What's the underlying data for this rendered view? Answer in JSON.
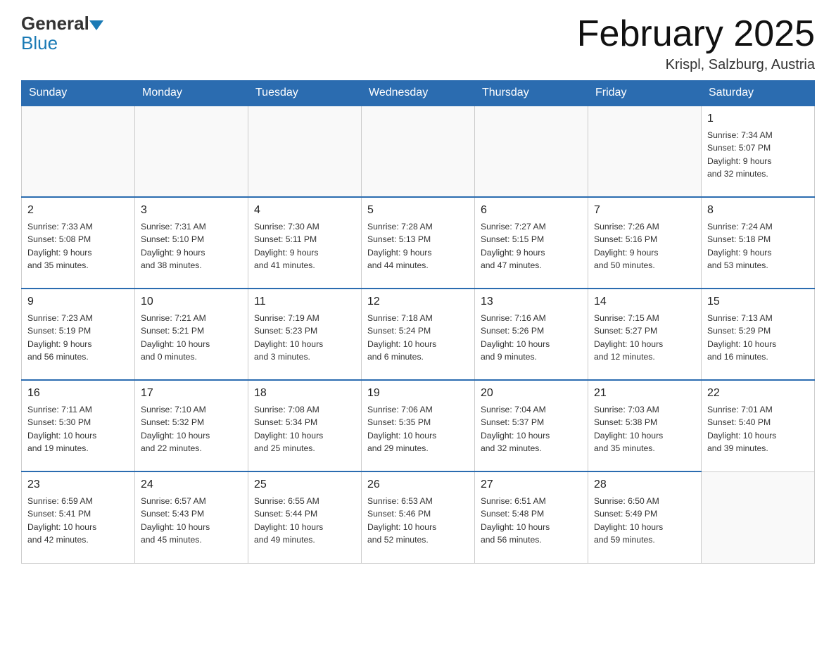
{
  "header": {
    "logo_general": "General",
    "logo_blue": "Blue",
    "title": "February 2025",
    "subtitle": "Krispl, Salzburg, Austria"
  },
  "weekdays": [
    "Sunday",
    "Monday",
    "Tuesday",
    "Wednesday",
    "Thursday",
    "Friday",
    "Saturday"
  ],
  "weeks": [
    [
      {
        "day": "",
        "info": ""
      },
      {
        "day": "",
        "info": ""
      },
      {
        "day": "",
        "info": ""
      },
      {
        "day": "",
        "info": ""
      },
      {
        "day": "",
        "info": ""
      },
      {
        "day": "",
        "info": ""
      },
      {
        "day": "1",
        "info": "Sunrise: 7:34 AM\nSunset: 5:07 PM\nDaylight: 9 hours\nand 32 minutes."
      }
    ],
    [
      {
        "day": "2",
        "info": "Sunrise: 7:33 AM\nSunset: 5:08 PM\nDaylight: 9 hours\nand 35 minutes."
      },
      {
        "day": "3",
        "info": "Sunrise: 7:31 AM\nSunset: 5:10 PM\nDaylight: 9 hours\nand 38 minutes."
      },
      {
        "day": "4",
        "info": "Sunrise: 7:30 AM\nSunset: 5:11 PM\nDaylight: 9 hours\nand 41 minutes."
      },
      {
        "day": "5",
        "info": "Sunrise: 7:28 AM\nSunset: 5:13 PM\nDaylight: 9 hours\nand 44 minutes."
      },
      {
        "day": "6",
        "info": "Sunrise: 7:27 AM\nSunset: 5:15 PM\nDaylight: 9 hours\nand 47 minutes."
      },
      {
        "day": "7",
        "info": "Sunrise: 7:26 AM\nSunset: 5:16 PM\nDaylight: 9 hours\nand 50 minutes."
      },
      {
        "day": "8",
        "info": "Sunrise: 7:24 AM\nSunset: 5:18 PM\nDaylight: 9 hours\nand 53 minutes."
      }
    ],
    [
      {
        "day": "9",
        "info": "Sunrise: 7:23 AM\nSunset: 5:19 PM\nDaylight: 9 hours\nand 56 minutes."
      },
      {
        "day": "10",
        "info": "Sunrise: 7:21 AM\nSunset: 5:21 PM\nDaylight: 10 hours\nand 0 minutes."
      },
      {
        "day": "11",
        "info": "Sunrise: 7:19 AM\nSunset: 5:23 PM\nDaylight: 10 hours\nand 3 minutes."
      },
      {
        "day": "12",
        "info": "Sunrise: 7:18 AM\nSunset: 5:24 PM\nDaylight: 10 hours\nand 6 minutes."
      },
      {
        "day": "13",
        "info": "Sunrise: 7:16 AM\nSunset: 5:26 PM\nDaylight: 10 hours\nand 9 minutes."
      },
      {
        "day": "14",
        "info": "Sunrise: 7:15 AM\nSunset: 5:27 PM\nDaylight: 10 hours\nand 12 minutes."
      },
      {
        "day": "15",
        "info": "Sunrise: 7:13 AM\nSunset: 5:29 PM\nDaylight: 10 hours\nand 16 minutes."
      }
    ],
    [
      {
        "day": "16",
        "info": "Sunrise: 7:11 AM\nSunset: 5:30 PM\nDaylight: 10 hours\nand 19 minutes."
      },
      {
        "day": "17",
        "info": "Sunrise: 7:10 AM\nSunset: 5:32 PM\nDaylight: 10 hours\nand 22 minutes."
      },
      {
        "day": "18",
        "info": "Sunrise: 7:08 AM\nSunset: 5:34 PM\nDaylight: 10 hours\nand 25 minutes."
      },
      {
        "day": "19",
        "info": "Sunrise: 7:06 AM\nSunset: 5:35 PM\nDaylight: 10 hours\nand 29 minutes."
      },
      {
        "day": "20",
        "info": "Sunrise: 7:04 AM\nSunset: 5:37 PM\nDaylight: 10 hours\nand 32 minutes."
      },
      {
        "day": "21",
        "info": "Sunrise: 7:03 AM\nSunset: 5:38 PM\nDaylight: 10 hours\nand 35 minutes."
      },
      {
        "day": "22",
        "info": "Sunrise: 7:01 AM\nSunset: 5:40 PM\nDaylight: 10 hours\nand 39 minutes."
      }
    ],
    [
      {
        "day": "23",
        "info": "Sunrise: 6:59 AM\nSunset: 5:41 PM\nDaylight: 10 hours\nand 42 minutes."
      },
      {
        "day": "24",
        "info": "Sunrise: 6:57 AM\nSunset: 5:43 PM\nDaylight: 10 hours\nand 45 minutes."
      },
      {
        "day": "25",
        "info": "Sunrise: 6:55 AM\nSunset: 5:44 PM\nDaylight: 10 hours\nand 49 minutes."
      },
      {
        "day": "26",
        "info": "Sunrise: 6:53 AM\nSunset: 5:46 PM\nDaylight: 10 hours\nand 52 minutes."
      },
      {
        "day": "27",
        "info": "Sunrise: 6:51 AM\nSunset: 5:48 PM\nDaylight: 10 hours\nand 56 minutes."
      },
      {
        "day": "28",
        "info": "Sunrise: 6:50 AM\nSunset: 5:49 PM\nDaylight: 10 hours\nand 59 minutes."
      },
      {
        "day": "",
        "info": ""
      }
    ]
  ]
}
